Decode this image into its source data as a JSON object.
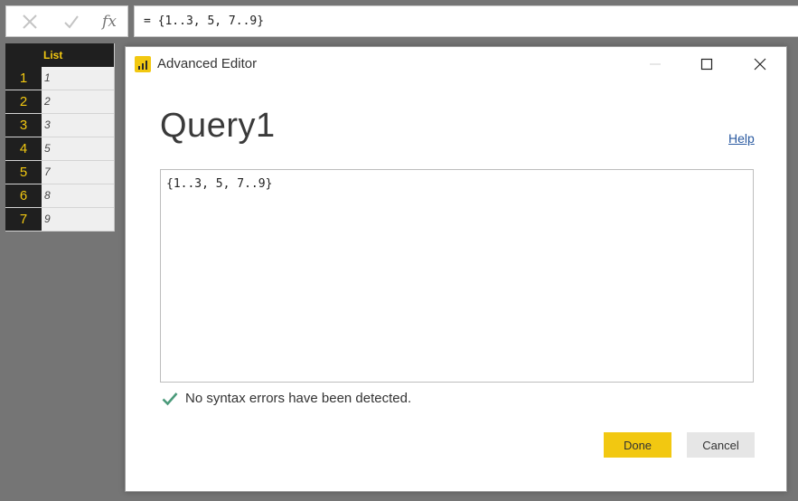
{
  "formula_bar": {
    "cancel_icon": "close-icon",
    "commit_icon": "checkmark-icon",
    "fx_label": "fx",
    "formula": "= {1..3, 5, 7..9}"
  },
  "grid": {
    "column_header": "List",
    "rows": [
      {
        "num": "1",
        "value": "1"
      },
      {
        "num": "2",
        "value": "2"
      },
      {
        "num": "3",
        "value": "3"
      },
      {
        "num": "4",
        "value": "5"
      },
      {
        "num": "5",
        "value": "7"
      },
      {
        "num": "6",
        "value": "8"
      },
      {
        "num": "7",
        "value": "9"
      }
    ]
  },
  "dialog": {
    "title": "Advanced Editor",
    "query_name": "Query1",
    "help_label": "Help",
    "code": "{1..3, 5, 7..9}",
    "status": "No syntax errors have been detected.",
    "done_label": "Done",
    "cancel_label": "Cancel"
  },
  "colors": {
    "accent": "#f2c811",
    "grid_header_bg": "#1f1f1f",
    "success": "#4a9a7a",
    "link": "#2a5aa0"
  }
}
